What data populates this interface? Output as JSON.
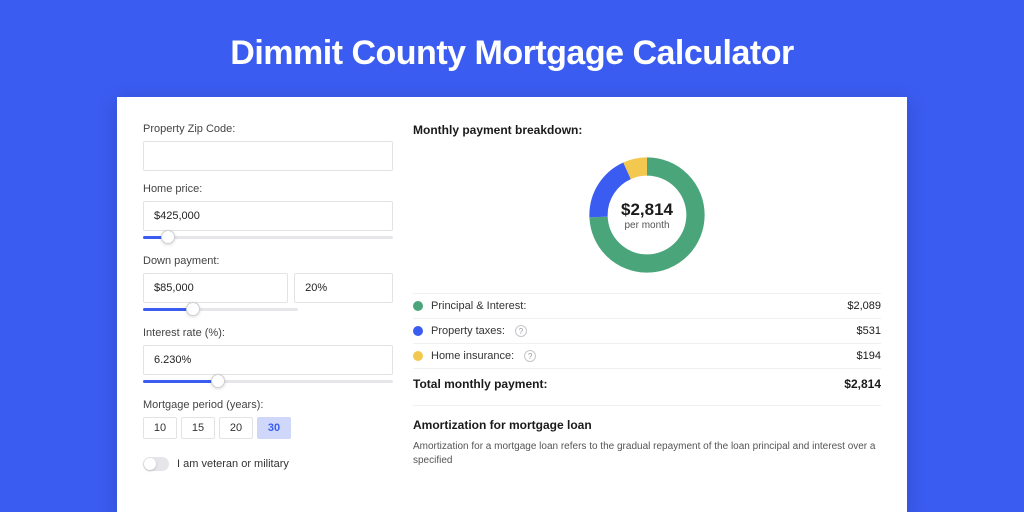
{
  "title": "Dimmit County Mortgage Calculator",
  "form": {
    "zip": {
      "label": "Property Zip Code:",
      "value": ""
    },
    "home_price": {
      "label": "Home price:",
      "value": "$425,000",
      "slider_pct": 10
    },
    "down_payment": {
      "label": "Down payment:",
      "amount": "$85,000",
      "percent": "20%",
      "slider_pct": 20
    },
    "interest_rate": {
      "label": "Interest rate (%):",
      "value": "6.230%",
      "slider_pct": 30
    },
    "period": {
      "label": "Mortgage period (years):",
      "options": [
        "10",
        "15",
        "20",
        "30"
      ],
      "selected": "30"
    },
    "veteran": {
      "label": "I am veteran or military",
      "on": false
    }
  },
  "breakdown": {
    "title": "Monthly payment breakdown:",
    "center_amount": "$2,814",
    "center_sub": "per month",
    "items": [
      {
        "label": "Principal & Interest:",
        "value": "$2,089",
        "color": "green",
        "info": false
      },
      {
        "label": "Property taxes:",
        "value": "$531",
        "color": "blue",
        "info": true
      },
      {
        "label": "Home insurance:",
        "value": "$194",
        "color": "yellow",
        "info": true
      }
    ],
    "total_label": "Total monthly payment:",
    "total_value": "$2,814"
  },
  "amortization": {
    "title": "Amortization for mortgage loan",
    "text": "Amortization for a mortgage loan refers to the gradual repayment of the loan principal and interest over a specified"
  },
  "chart_data": {
    "type": "pie",
    "title": "Monthly payment breakdown",
    "series": [
      {
        "name": "Principal & Interest",
        "value": 2089,
        "color": "#4aa57b"
      },
      {
        "name": "Property taxes",
        "value": 531,
        "color": "#3a5cf0"
      },
      {
        "name": "Home insurance",
        "value": 194,
        "color": "#f3c84f"
      }
    ],
    "total": 2814,
    "center_label": "$2,814 per month"
  }
}
